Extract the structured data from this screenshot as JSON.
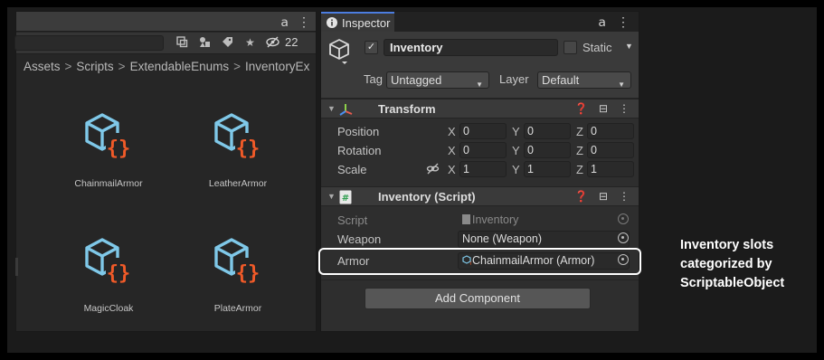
{
  "project": {
    "hidden_count": "22",
    "breadcrumb": [
      "Assets",
      "Scripts",
      "ExtendableEnums",
      "InventoryEx"
    ],
    "breadcrumb_sep": ">",
    "assets": [
      {
        "name": "ChainmailArmor"
      },
      {
        "name": "LeatherArmor"
      },
      {
        "name": "MagicCloak"
      },
      {
        "name": "PlateArmor"
      }
    ]
  },
  "inspector": {
    "tab_label": "Inspector",
    "go_name": "Inventory",
    "static_label": "Static",
    "tag_label": "Tag",
    "tag_value": "Untagged",
    "layer_label": "Layer",
    "layer_value": "Default",
    "transform": {
      "title": "Transform",
      "rows": [
        {
          "label": "Position",
          "x": "0",
          "y": "0",
          "z": "0"
        },
        {
          "label": "Rotation",
          "x": "0",
          "y": "0",
          "z": "0"
        },
        {
          "label": "Scale",
          "x": "1",
          "y": "1",
          "z": "1"
        }
      ],
      "axis_x": "X",
      "axis_y": "Y",
      "axis_z": "Z"
    },
    "script_component": {
      "title": "Inventory (Script)",
      "script_label": "Script",
      "script_value": "Inventory",
      "weapon_label": "Weapon",
      "weapon_value": "None (Weapon)",
      "armor_label": "Armor",
      "armor_value": "ChainmailArmor (Armor)"
    },
    "add_component": "Add Component"
  },
  "callout": {
    "line1": "Inventory slots",
    "line2": "categorized by",
    "line3": "ScriptableObject"
  },
  "colors": {
    "accent_blue": "#4c7de0",
    "asset_icon_blue": "#7fc8e8",
    "asset_icon_orange": "#f05a28"
  }
}
